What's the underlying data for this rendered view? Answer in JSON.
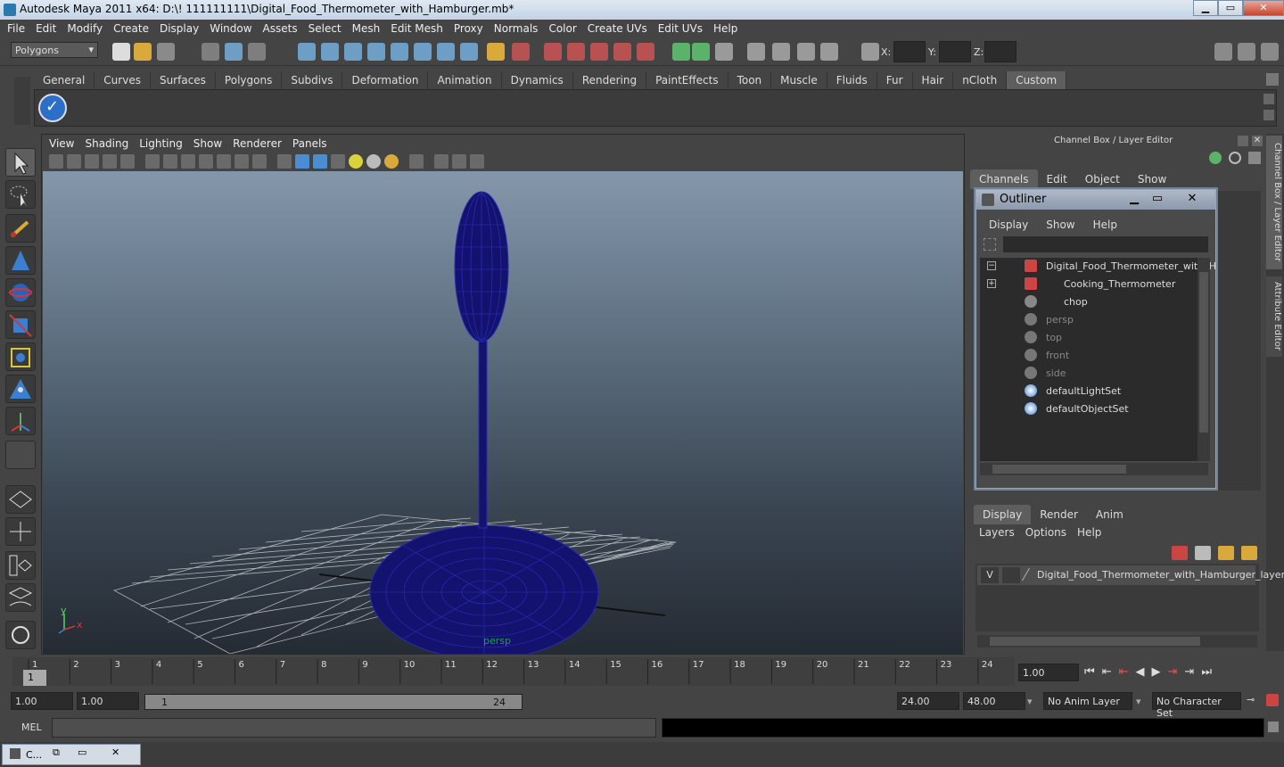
{
  "window": {
    "title": "Autodesk Maya 2011 x64: D:\\! 111111111\\Digital_Food_Thermometer_with_Hamburger.mb*",
    "min": "▁",
    "max": "▭",
    "close": "✕"
  },
  "menubar": [
    "File",
    "Edit",
    "Modify",
    "Create",
    "Display",
    "Window",
    "Assets",
    "Select",
    "Mesh",
    "Edit Mesh",
    "Proxy",
    "Normals",
    "Color",
    "Create UVs",
    "Edit UVs",
    "Help"
  ],
  "status": {
    "mode": "Polygons",
    "x_label": "X:",
    "y_label": "Y:",
    "z_label": "Z:"
  },
  "shelf": {
    "tabs": [
      "General",
      "Curves",
      "Surfaces",
      "Polygons",
      "Subdivs",
      "Deformation",
      "Animation",
      "Dynamics",
      "Rendering",
      "PaintEffects",
      "Toon",
      "Muscle",
      "Fluids",
      "Fur",
      "Hair",
      "nCloth",
      "Custom"
    ],
    "active": "Custom"
  },
  "viewport": {
    "menu": [
      "View",
      "Shading",
      "Lighting",
      "Show",
      "Renderer",
      "Panels"
    ],
    "camera_label": "persp",
    "axis_y": "y",
    "axis_x": "x"
  },
  "channelbox": {
    "title": "Channel Box / Layer Editor",
    "menu": [
      "Channels",
      "Edit",
      "Object",
      "Show"
    ],
    "side_tab1": "Channel Box / Layer Editor",
    "side_tab2": "Attribute Editor"
  },
  "outliner": {
    "title": "Outliner",
    "menu": [
      "Display",
      "Show",
      "Help"
    ],
    "items": [
      {
        "label": "Digital_Food_Thermometer_with_H",
        "dim": false
      },
      {
        "label": "Cooking_Thermometer",
        "dim": false
      },
      {
        "label": "chop",
        "dim": false
      },
      {
        "label": "persp",
        "dim": true
      },
      {
        "label": "top",
        "dim": true
      },
      {
        "label": "front",
        "dim": true
      },
      {
        "label": "side",
        "dim": true
      },
      {
        "label": "defaultLightSet",
        "dim": false
      },
      {
        "label": "defaultObjectSet",
        "dim": false
      }
    ]
  },
  "layers": {
    "tabs": [
      "Display",
      "Render",
      "Anim"
    ],
    "active": "Display",
    "menu": [
      "Layers",
      "Options",
      "Help"
    ],
    "layer_v": "V",
    "layer_name": "Digital_Food_Thermometer_with_Hamburger_layer"
  },
  "timeline": {
    "ticks": [
      "1",
      "2",
      "3",
      "4",
      "5",
      "6",
      "7",
      "8",
      "9",
      "10",
      "11",
      "12",
      "13",
      "14",
      "15",
      "16",
      "17",
      "18",
      "19",
      "20",
      "21",
      "22",
      "23",
      "24"
    ],
    "current": "1",
    "current_time": "1.00"
  },
  "range": {
    "start": "1.00",
    "start2": "1.00",
    "slider_start": "1",
    "slider_end": "24",
    "end": "24.00",
    "end2": "48.00",
    "anim_layer": "No Anim Layer",
    "char_set": "No Character Set"
  },
  "cmd": {
    "label": "MEL"
  },
  "taskbar": {
    "label": "C..."
  }
}
